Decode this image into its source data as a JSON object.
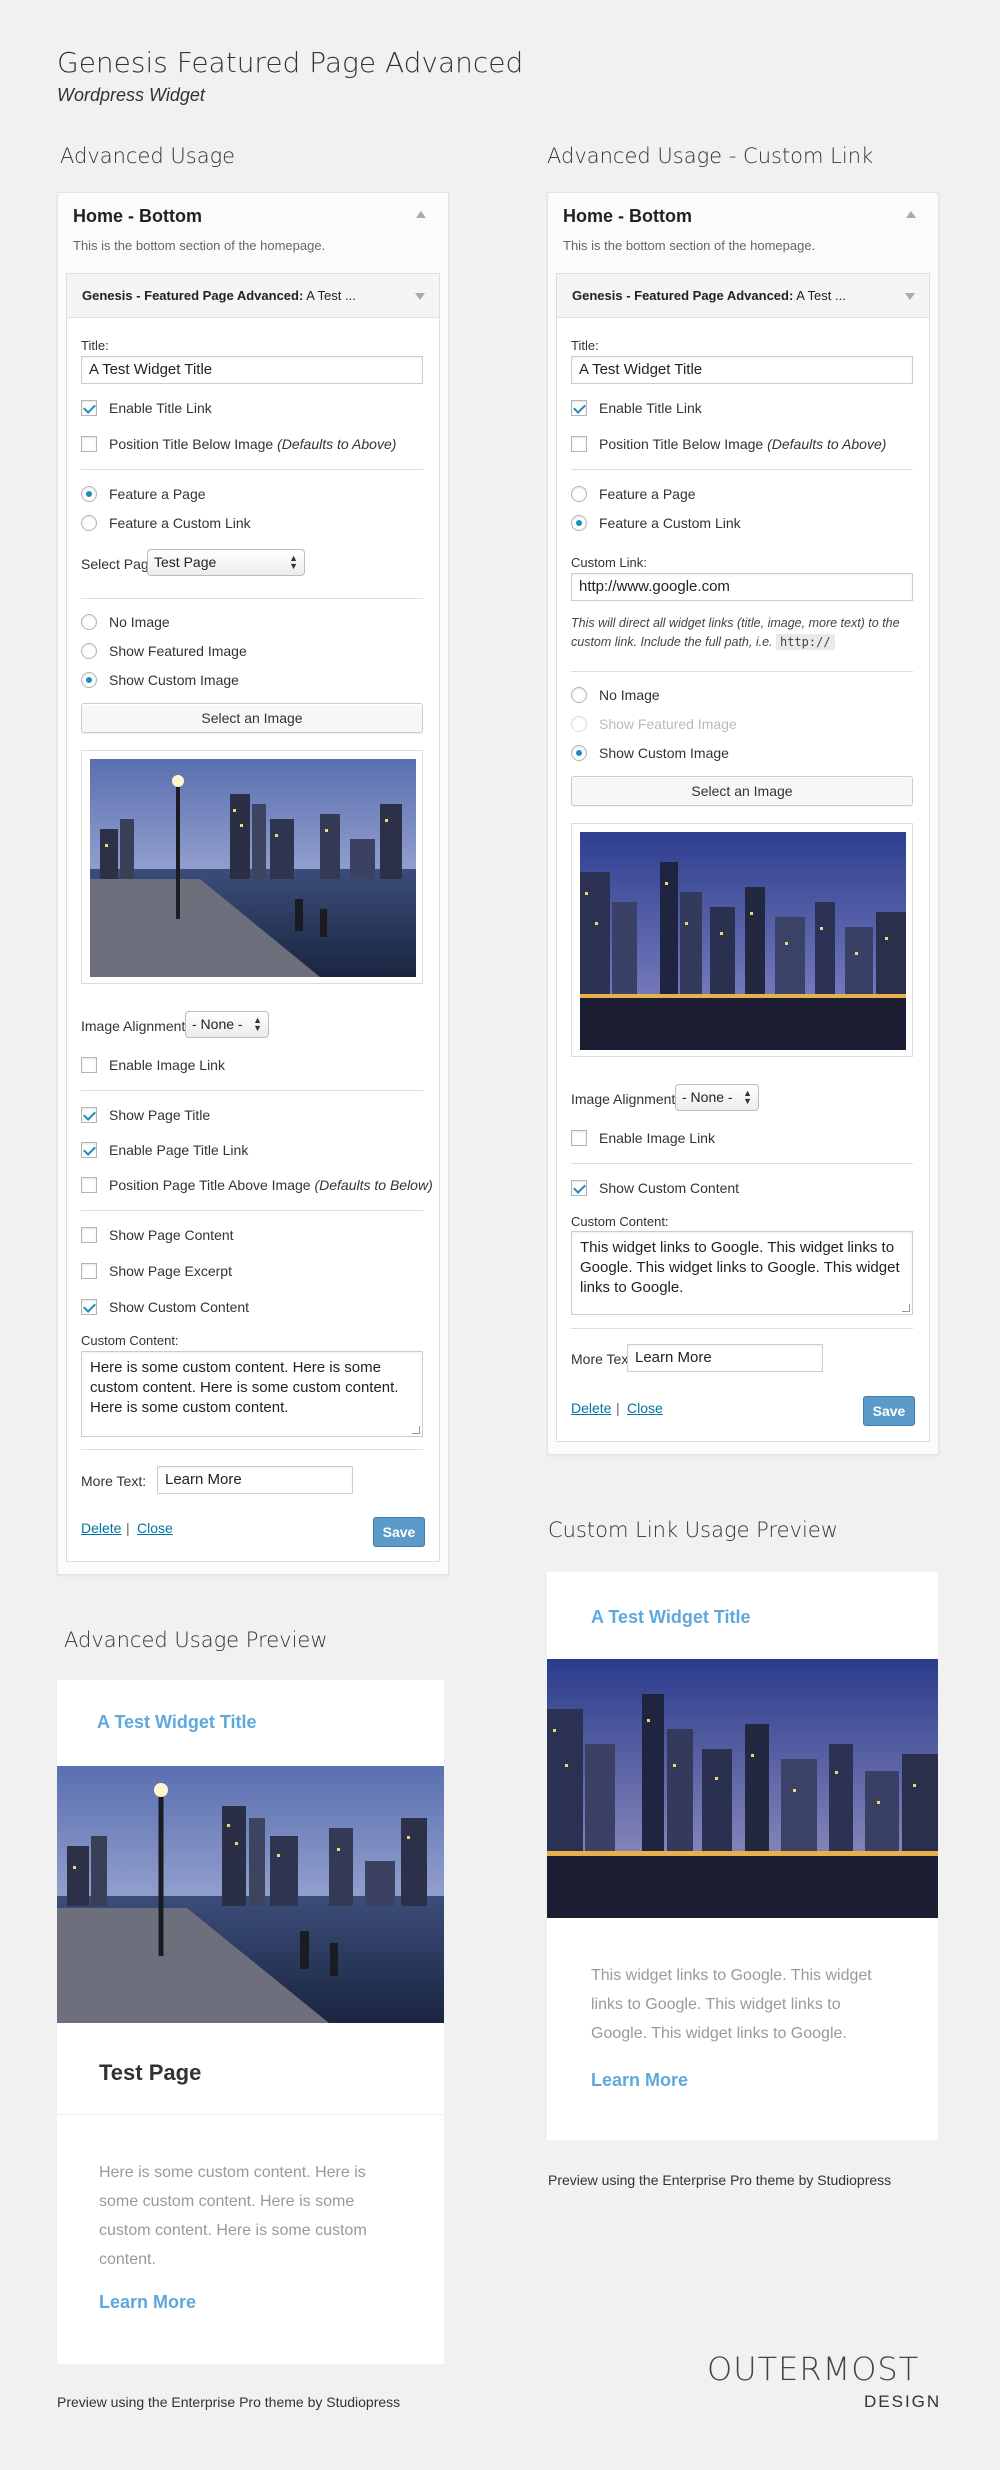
{
  "header": {
    "title": "Genesis Featured Page Advanced",
    "subtitle": "Wordpress Widget"
  },
  "left": {
    "section_title": "Advanced Usage",
    "area_title": "Home - Bottom",
    "area_desc": "This is the bottom section of the homepage.",
    "widget_bar_bold": "Genesis - Featured Page Advanced:",
    "widget_bar_rest": " A Test ...",
    "title_label": "Title:",
    "title_value": "A Test Widget Title",
    "enable_title_link": "Enable Title Link",
    "position_title_below": "Position Title Below Image ",
    "position_title_below_note": "(Defaults to Above)",
    "feature_page": "Feature a Page",
    "feature_custom_link": "Feature a Custom Link",
    "select_page_label": "Select Page:",
    "select_page_value": "Test Page",
    "no_image": "No Image",
    "show_featured_image": "Show Featured Image",
    "show_custom_image": "Show Custom Image",
    "select_image_button": "Select an Image",
    "image_alignment_label": "Image Alignment:",
    "image_alignment_value": "- None -",
    "enable_image_link": "Enable Image Link",
    "show_page_title": "Show Page Title",
    "enable_page_title_link": "Enable Page Title Link",
    "position_page_title_above": "Position Page Title Above Image ",
    "position_page_title_above_note": "(Defaults to Below)",
    "show_page_content": "Show Page Content",
    "show_page_excerpt": "Show Page Excerpt",
    "show_custom_content": "Show Custom Content",
    "custom_content_label": "Custom Content:",
    "custom_content_value": "Here is some custom content. Here is some custom content. Here is some custom content. Here is some custom content.",
    "more_text_label": "More Text:",
    "more_text_value": "Learn More",
    "delete": "Delete",
    "separator": "|",
    "close": "Close",
    "save": "Save"
  },
  "right": {
    "section_title": "Advanced Usage - Custom Link",
    "area_title": "Home - Bottom",
    "area_desc": "This is the bottom section of the homepage.",
    "widget_bar_bold": "Genesis - Featured Page Advanced:",
    "widget_bar_rest": " A Test ...",
    "title_label": "Title:",
    "title_value": "A Test Widget Title",
    "enable_title_link": "Enable Title Link",
    "position_title_below": "Position Title Below Image ",
    "position_title_below_note": "(Defaults to Above)",
    "feature_page": "Feature a Page",
    "feature_custom_link": "Feature a Custom Link",
    "custom_link_label": "Custom Link:",
    "custom_link_value": "http://www.google.com",
    "custom_link_help": "This will direct all widget links (title, image, more text) to the custom link. Include the full path, i.e. ",
    "custom_link_help_code": "http://",
    "no_image": "No Image",
    "show_featured_image": "Show Featured Image",
    "show_custom_image": "Show Custom Image",
    "select_image_button": "Select an Image",
    "image_alignment_label": "Image Alignment:",
    "image_alignment_value": "- None -",
    "enable_image_link": "Enable Image Link",
    "show_custom_content": "Show Custom Content",
    "custom_content_label": "Custom Content:",
    "custom_content_value": "This widget links to Google. This widget links to Google. This widget links to Google. This widget links to Google.",
    "more_text_label": "More Text:",
    "more_text_value": "Learn More",
    "delete": "Delete",
    "separator": "|",
    "close": "Close",
    "save": "Save"
  },
  "preview_left": {
    "section_title": "Advanced Usage Preview",
    "widget_title": "A Test Widget Title",
    "page_title": "Test Page",
    "body": "Here is some custom content. Here is some custom content. Here is some custom content. Here is some custom content.",
    "more": "Learn More",
    "caption": "Preview using the Enterprise Pro theme by Studiopress"
  },
  "preview_right": {
    "section_title": "Custom Link Usage Preview",
    "widget_title": "A Test Widget Title",
    "body": "This widget links to Google. This widget links to Google. This widget links to Google. This widget links to Google.",
    "more": "Learn More",
    "caption": "Preview using the Enterprise Pro theme by Studiopress"
  },
  "logo": {
    "line1": "OUTERMOST",
    "line2": "DESIGN"
  },
  "colors": {
    "accent": "#5fa8dd",
    "save": "#5b9ac9",
    "check": "#1e8cbe",
    "link": "#0074a2"
  }
}
